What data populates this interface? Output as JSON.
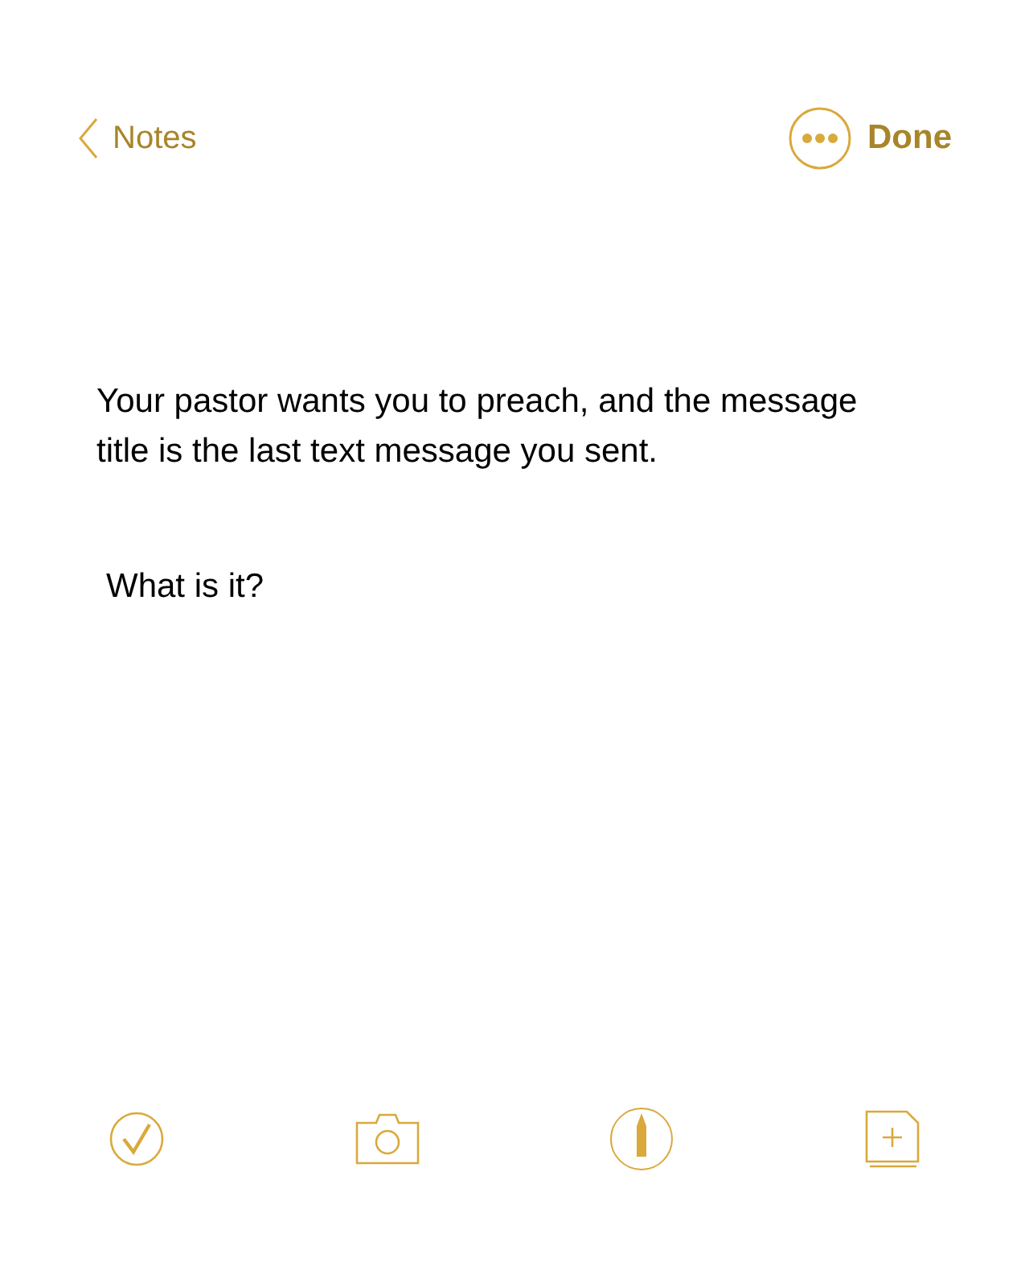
{
  "nav": {
    "back_label": "Notes",
    "done_label": "Done"
  },
  "note": {
    "paragraphs": [
      "Your pastor wants you to preach, and the message title is the last text message you sent.",
      "What is it?"
    ]
  }
}
